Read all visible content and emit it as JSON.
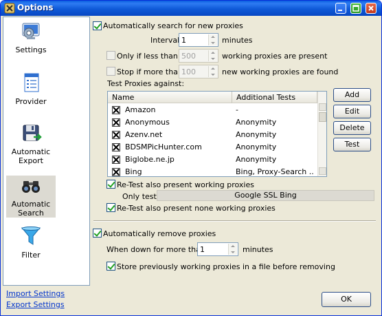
{
  "window": {
    "title": "Options"
  },
  "sidebar": {
    "items": [
      {
        "label": "Settings",
        "icon": "settings-icon"
      },
      {
        "label": "Provider",
        "icon": "provider-icon"
      },
      {
        "label": "Automatic Export",
        "icon": "floppy-disk-icon"
      },
      {
        "label": "Automatic Search",
        "icon": "binoculars-icon",
        "selected": true
      },
      {
        "label": "Filter",
        "icon": "funnel-icon"
      }
    ],
    "import_link": "Import Settings",
    "export_link": "Export Settings"
  },
  "search": {
    "auto_search_label": "Automatically search for new proxies",
    "auto_search_checked": true,
    "interval_label": "Interval",
    "interval_value": "1",
    "interval_unit": "minutes",
    "only_if_less_label": "Only if less than",
    "only_if_less_value": "500",
    "only_if_less_suffix": "working proxies are present",
    "stop_if_more_label": "Stop if more than",
    "stop_if_more_value": "100",
    "stop_if_more_suffix": "new working proxies are found",
    "test_against_label": "Test Proxies against:"
  },
  "table": {
    "columns": [
      "Name",
      "Additional Tests"
    ],
    "rows": [
      {
        "name": "Amazon",
        "tests": "-"
      },
      {
        "name": "Anonymous",
        "tests": "Anonymity"
      },
      {
        "name": "Azenv.net",
        "tests": "Anonymity"
      },
      {
        "name": "BDSMPicHunter.com",
        "tests": "Anonymity"
      },
      {
        "name": "Biglobe.ne.jp",
        "tests": "Anonymity"
      },
      {
        "name": "Bing",
        "tests": "Bing, Proxy-Search ..."
      }
    ]
  },
  "buttons": {
    "add": "Add",
    "edit": "Edit",
    "delete": "Delete",
    "test": "Test",
    "ok": "OK"
  },
  "retest": {
    "working_label": "Re-Test also present working proxies",
    "only_test_label": "Only test",
    "only_test_value": "Google SSL Bing",
    "none_working_label": "Re-Test also present none working proxies"
  },
  "remove": {
    "auto_remove_label": "Automatically remove proxies",
    "down_label": "When down for more than",
    "down_value": "1",
    "down_unit": "minutes",
    "store_label": "Store previously working proxies in a file before removing"
  },
  "colors": {
    "title_bar": "#0a5fe0",
    "face": "#ece9d8",
    "link": "#0033cc"
  }
}
